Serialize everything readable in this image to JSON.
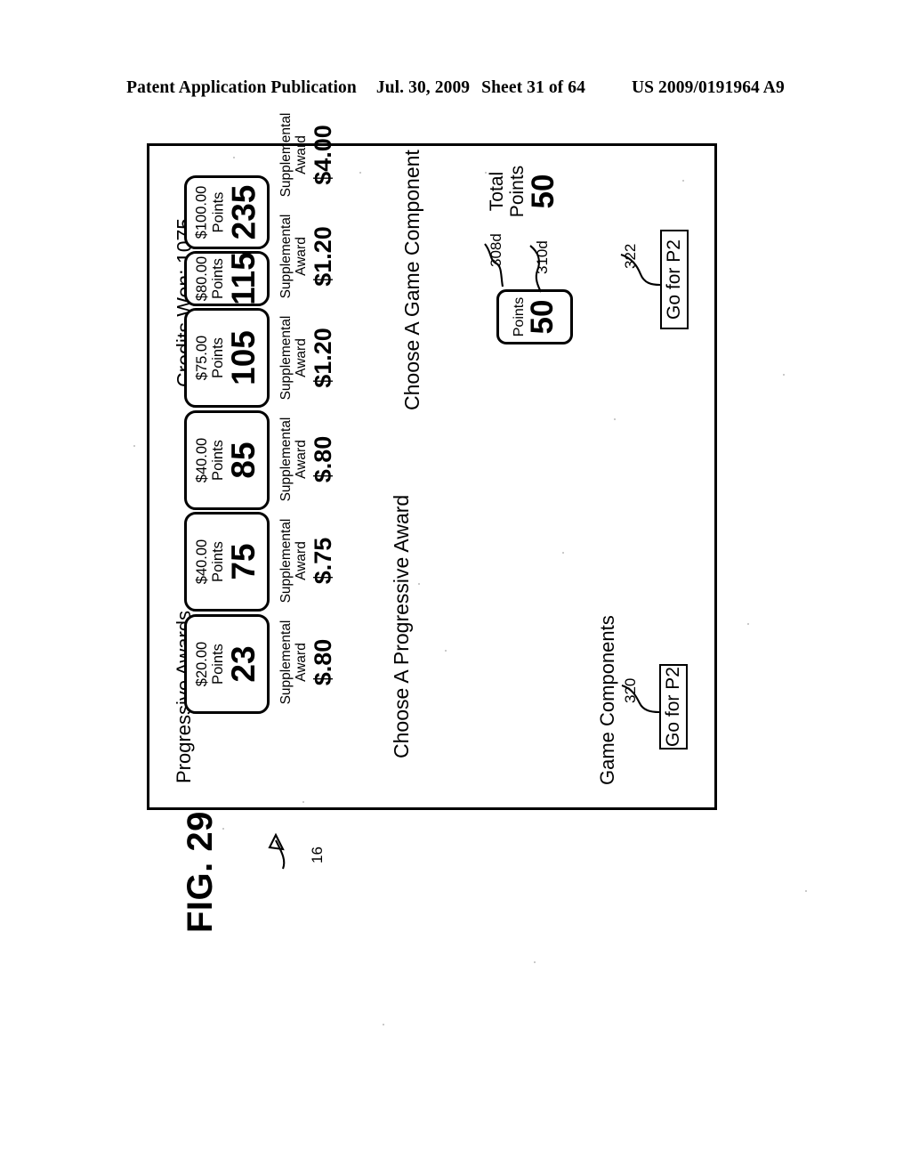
{
  "header": {
    "publication": "Patent Application Publication",
    "date": "Jul. 30, 2009",
    "sheet": "Sheet 31 of 64",
    "patent_number": "US 2009/0191964 A9"
  },
  "figure": {
    "label": "FIG. 29",
    "screen_reference_numeral": "16"
  },
  "screen": {
    "progressive_awards_heading": "Progressive Awards",
    "credits_won": "Credits Won: 1075",
    "choose_progressive_prompt": "Choose A Progressive Award",
    "choose_component_prompt": "Choose A Game Component",
    "game_components_heading": "Game Components",
    "awards": [
      {
        "amount": "$20.00",
        "points_label": "Points",
        "points": "23",
        "supplemental_line1": "Supplemental",
        "supplemental_line2": "Award",
        "supplemental_value": "$.80"
      },
      {
        "amount": "$40.00",
        "points_label": "Points",
        "points": "75",
        "supplemental_line1": "Supplemental",
        "supplemental_line2": "Award",
        "supplemental_value": "$.75"
      },
      {
        "amount": "$40.00",
        "points_label": "Points",
        "points": "85",
        "supplemental_line1": "Supplemental",
        "supplemental_line2": "Award",
        "supplemental_value": "$.80"
      },
      {
        "amount": "$75.00",
        "points_label": "Points",
        "points": "105",
        "supplemental_line1": "Supplemental",
        "supplemental_line2": "Award",
        "supplemental_value": "$1.20"
      },
      {
        "amount": "$80.00",
        "points_label": "Points",
        "points": "115",
        "supplemental_line1": "Supplemental",
        "supplemental_line2": "Award",
        "supplemental_value": "$1.20"
      },
      {
        "amount": "$100.00",
        "points_label": "Points",
        "points": "235",
        "supplemental_line1": "Supplemental",
        "supplemental_line2": "Award",
        "supplemental_value": "$4.00"
      }
    ],
    "points_box": {
      "label": "Points",
      "value": "50",
      "box_numeral": "308d",
      "value_numeral": "310d"
    },
    "total_points": {
      "line1": "Total",
      "line2": "Points",
      "value": "50"
    },
    "buttons": [
      {
        "label": "Go for P2",
        "numeral": "320"
      },
      {
        "label": "Go for P2",
        "numeral": "322"
      }
    ]
  }
}
